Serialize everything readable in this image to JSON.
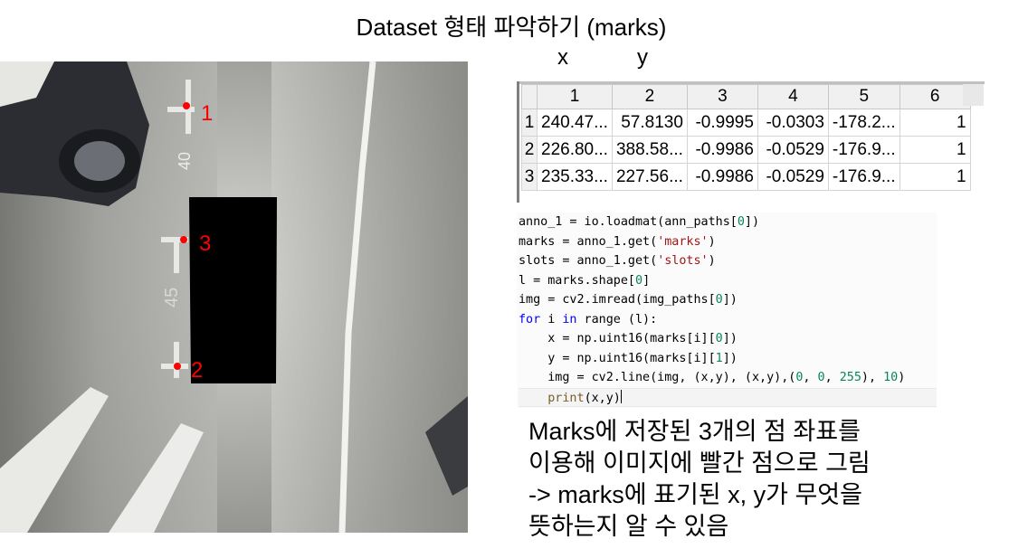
{
  "title": "Dataset 형태 파악하기 (marks)",
  "column_letters": {
    "x": "x",
    "y": "y"
  },
  "photo": {
    "marks": [
      {
        "label": "1",
        "color": "#ff0000"
      },
      {
        "label": "3",
        "color": "#ff0000"
      },
      {
        "label": "2",
        "color": "#ff0000"
      }
    ],
    "floor_text": [
      "40",
      "45"
    ]
  },
  "variable_viewer": {
    "columns": [
      "1",
      "2",
      "3",
      "4",
      "5",
      "6"
    ],
    "rows": [
      {
        "index": "1",
        "cells": [
          "240.47...",
          "57.8130",
          "-0.9995",
          "-0.0303",
          "-178.2...",
          "1"
        ]
      },
      {
        "index": "2",
        "cells": [
          "226.80...",
          "388.58...",
          "-0.9986",
          "-0.0529",
          "-176.9...",
          "1"
        ]
      },
      {
        "index": "3",
        "cells": [
          "235.33...",
          "227.56...",
          "-0.9986",
          "-0.0529",
          "-176.9...",
          "1"
        ]
      }
    ]
  },
  "code": {
    "l1": {
      "a": "anno_1 = io.loadmat(ann_paths[",
      "n": "0",
      "b": "])"
    },
    "l2": {
      "a": "marks = anno_1.get(",
      "s": "'marks'",
      "b": ")"
    },
    "l3": {
      "a": "slots = anno_1.get(",
      "s": "'slots'",
      "b": ")"
    },
    "l4": {
      "a": "l = marks.shape[",
      "n": "0",
      "b": "]"
    },
    "l5": {
      "a": "img = cv2.imread(img_paths[",
      "n": "0",
      "b": "])"
    },
    "l6": {
      "k1": "for",
      "a": " i ",
      "k2": "in",
      "b": " range (l):"
    },
    "l7": {
      "a": "    x = np.uint16(marks[i][",
      "n": "0",
      "b": "])"
    },
    "l8": {
      "a": "    y = np.uint16(marks[i][",
      "n": "1",
      "b": "])"
    },
    "l9": {
      "a": "    img = cv2.line(img, (x,y), (x,y),(",
      "n1": "0",
      "c1": ", ",
      "n2": "0",
      "c2": ", ",
      "n3": "255",
      "c3": "), ",
      "n4": "10",
      "b": ")"
    },
    "l10": {
      "indent": "    ",
      "f": "print",
      "b": "(x,y)"
    }
  },
  "note_lines": [
    "Marks에 저장된 3개의 점 좌표를",
    "이용해 이미지에 빨간 점으로 그림",
    "-> marks에 표기된 x, y가 무엇을",
    "뜻하는지 알 수 있음"
  ]
}
